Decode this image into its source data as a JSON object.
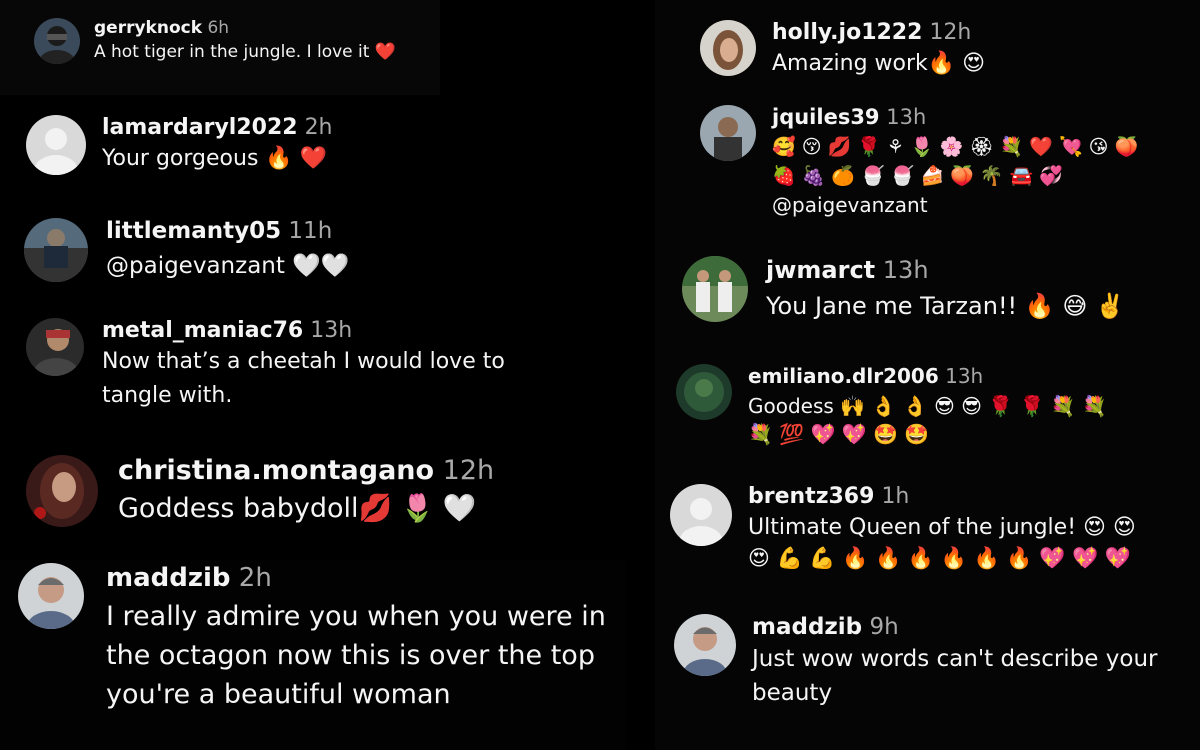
{
  "comments": [
    {
      "user": "gerryknock",
      "time": "6h",
      "text": "A hot tiger in the jungle. I love it ❤️"
    },
    {
      "user": "lamardaryl2022",
      "time": "2h",
      "text": "Your gorgeous 🔥 ❤️"
    },
    {
      "user": "littlemanty05",
      "time": "11h",
      "text": "@paigevanzant 🤍🤍"
    },
    {
      "user": "metal_maniac76",
      "time": "13h",
      "text": "Now that’s a cheetah I would love to tangle with."
    },
    {
      "user": "christina.montagano",
      "time": "12h",
      "text": "Goddess babydoll💋 🌷 🤍"
    },
    {
      "user": "maddzib",
      "time": "2h",
      "text": "I really admire you when you were in the octagon now this is over the top you're a beautiful woman"
    },
    {
      "user": "holly.jo1222",
      "time": "12h",
      "text": "Amazing work🔥 😍"
    },
    {
      "user": "jquiles39",
      "time": "13h",
      "text": "🥰 😚 💋 🌹 ⚘ 🌷 🌸 🏵 💐 ❤️ 💘 😘 🍑",
      "text2": "🍓 🍇 🍊 🍧 🍧 🍰 🍑 🌴 🚘 💞",
      "mention": "@paigevanzant"
    },
    {
      "user": "jwmarct",
      "time": "13h",
      "text": "You Jane me Tarzan!! 🔥 😅 ✌️"
    },
    {
      "user": "emiliano.dlr2006",
      "time": "13h",
      "text": "Goodess 🙌 👌 👌 😎 😎 🌹 🌹 💐 💐",
      "text2": "💐 💯 💖 💖 🤩 🤩"
    },
    {
      "user": "brentz369",
      "time": "1h",
      "text": "Ultimate Queen of the jungle! 😍 😍",
      "text2": "😍 💪 💪 🔥 🔥 🔥 🔥 🔥 🔥 💖 💖 💖"
    },
    {
      "user": "maddzib",
      "time": "9h",
      "text": "Just wow words can't describe your beauty"
    }
  ]
}
